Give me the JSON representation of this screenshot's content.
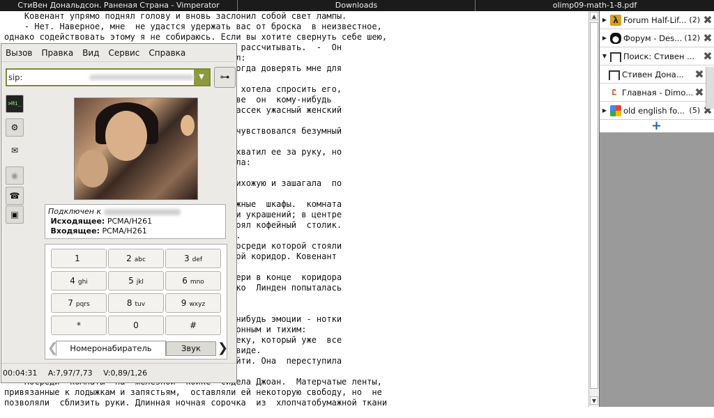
{
  "topbar": {
    "tab1": "СтиВен Дональдсон. Раненая Страна - Vimperator",
    "tab2": "Downloads",
    "tab3": "olimp09-math-1-8.pdf"
  },
  "document": {
    "lines": [
      "    Ковенант упрямо поднял голову и вновь заслонил собой свет лампы.",
      "    - Нет. Наверное, мне  не удастся удержать вас от броска  в неизвестное,",
      "однако содействовать этому я не собираюсь. Если вы хотите свернуть себе шею,",
      "                                      кете  не рассчитывать.  -  Он",
      "                                      о добавил:",
      "                                      ог бы иногда доверять мне для",
      "",
      "                                      вет. Она хотела спросить его,",
      "                                      нем? Разве  он  кому-нибудь",
      "                                      тишину рассек ужасный женский",
      "",
      "                                      голосе  чувствовался безумный",
      "",
      "                                      венант схватил ее за руку, но",
      "                                      произнесла:",
      "",
      "                                      а  в  прихожую и зашагала  по",
      "",
      "                                      о  и книжные  шкафы.  комната",
      "                                      артин, ни украшений; в центре",
      "                                      торой стоял кофейный  столик.",
      "                                      транство.",
      "                                      кухню, посреди которой стояли",
      "                                       небольшой коридор. Ковенант",
      "",
      "                                      ась к двери в конце  коридора",
      "                                      Как только  Линден попыталась",
      "",
      "",
      "                                      м какой-нибудь эмоции - нотки",
      "                                      ыл монотонным и тихим:",
      "                                      ть человеку, который уже  все",
      "                                      оманном виде.",
      "                                      в  ей войти. Она  переступила",
      "",
      "    Посреди  комнаты  на  железной  койке  сидела Джоан.  Матерчатые ленты,",
      "привязанные к лодыжкам и запястьям,  оставляли ей некоторую свободу, но  не",
      "позволяли  сблизить руки. Длинная ночная сорочка  из  хлопчатобумажной ткани"
    ]
  },
  "sidebar": {
    "tabs": [
      {
        "label": "Forum Half-Lif...",
        "count": "(2)",
        "icon": "half-life-icon"
      },
      {
        "label": "Форум - Des...",
        "count": "(12)",
        "icon": "penguin-icon"
      },
      {
        "label": "Поиск: Стивен ...",
        "count": "",
        "icon": "arch-icon"
      },
      {
        "label": "Стивен Дона...",
        "count": "",
        "icon": "arch-icon"
      },
      {
        "label": "Главная - Dimo...",
        "count": "",
        "icon": "dimo-icon"
      },
      {
        "label": "old english fo...",
        "count": "(5)",
        "icon": "google-icon"
      }
    ],
    "plus": "+"
  },
  "phone": {
    "menu": [
      "Вызов",
      "Правка",
      "Вид",
      "Сервис",
      "Справка"
    ],
    "sip_value": "sip:",
    "side_buttons": [
      ">Hi_",
      "⚙",
      "✉",
      "◉",
      "☎",
      "▣"
    ],
    "info": {
      "connected": "Подключен к",
      "out_label": "Исходящее:",
      "out_value": "PCMA/H261",
      "in_label": "Входящее:",
      "in_value": "PCMA/H261"
    },
    "keys": [
      {
        "d": "1",
        "l": ""
      },
      {
        "d": "2",
        "l": "abc"
      },
      {
        "d": "3",
        "l": "def"
      },
      {
        "d": "4",
        "l": "ghi"
      },
      {
        "d": "5",
        "l": "jkl"
      },
      {
        "d": "6",
        "l": "mno"
      },
      {
        "d": "7",
        "l": "pqrs"
      },
      {
        "d": "8",
        "l": "tuv"
      },
      {
        "d": "9",
        "l": "wxyz"
      },
      {
        "d": "*",
        "l": ""
      },
      {
        "d": "0",
        "l": ""
      },
      {
        "d": "#",
        "l": ""
      }
    ],
    "tab_dialer": "Номеронабиратель",
    "tab_sound": "Звук",
    "status": {
      "time": "00:04:31",
      "audio": "A:7,97/7,73",
      "video": "V:0,89/1,26"
    }
  }
}
